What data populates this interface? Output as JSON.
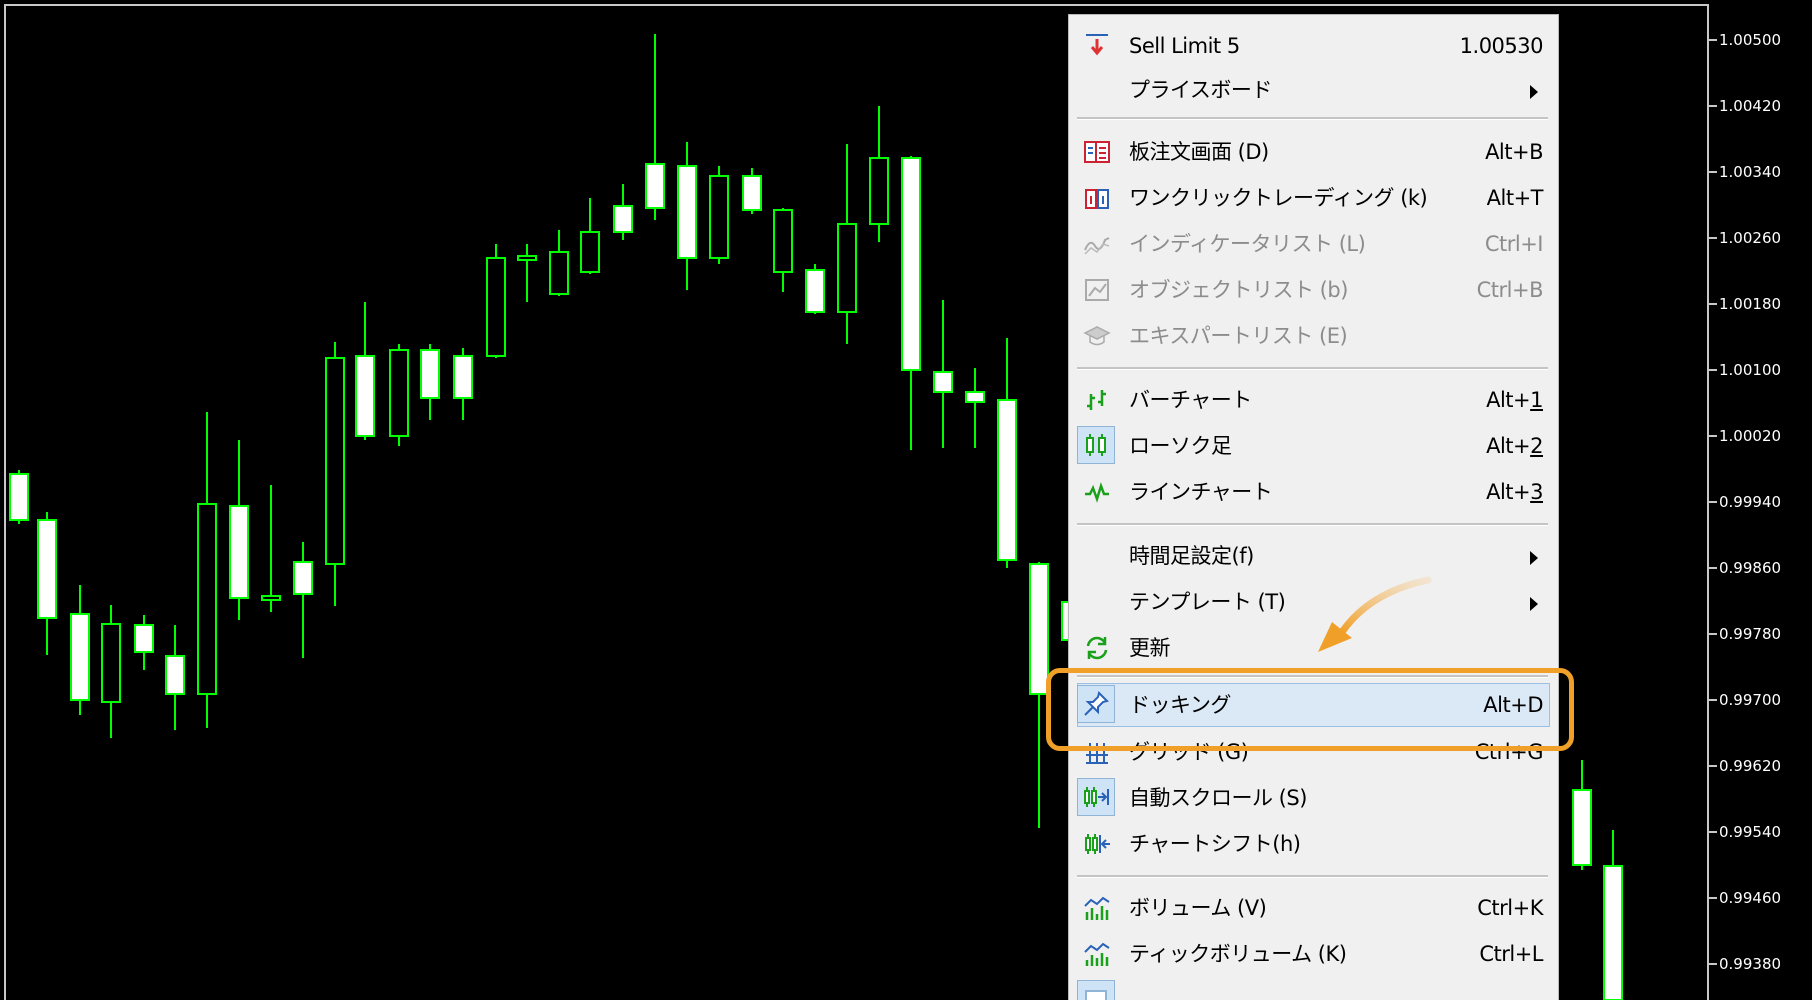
{
  "price_scale": {
    "labels": [
      "1.00500",
      "1.00420",
      "1.00340",
      "1.00260",
      "1.00180",
      "1.00100",
      "1.00020",
      "0.99940",
      "0.99860",
      "0.99780",
      "0.99700",
      "0.99620",
      "0.99540",
      "0.99460",
      "0.99380"
    ]
  },
  "chart": {
    "background": "#000000",
    "candle_up_body": "#ffffff",
    "outline": "#00ff00"
  },
  "menu": {
    "sell_limit": {
      "label": "Sell Limit 5",
      "value": "1.00530"
    },
    "price_board": {
      "label": "プライスボード"
    },
    "depth_of_market": {
      "label": "板注文画面 (D)",
      "shortcut": "Alt+B"
    },
    "one_click": {
      "label": "ワンクリックトレーディング (k)",
      "shortcut": "Alt+T"
    },
    "indicator_list": {
      "label": "インディケータリスト (L)",
      "shortcut": "Ctrl+I",
      "disabled": true
    },
    "object_list": {
      "label": "オブジェクトリスト (b)",
      "shortcut": "Ctrl+B",
      "disabled": true
    },
    "expert_list": {
      "label": "エキスパートリスト (E)",
      "disabled": true
    },
    "bar_chart": {
      "label": "バーチャート",
      "shortcut_prefix": "Alt+",
      "shortcut_key": "1"
    },
    "candlestick": {
      "label": "ローソク足",
      "shortcut_prefix": "Alt+",
      "shortcut_key": "2",
      "checked": true
    },
    "line_chart": {
      "label": "ラインチャート",
      "shortcut_prefix": "Alt+",
      "shortcut_key": "3"
    },
    "timeframe": {
      "label": "時間足設定(f)"
    },
    "template": {
      "label": "テンプレート (T)"
    },
    "refresh": {
      "label": "更新"
    },
    "docking": {
      "label": "ドッキング",
      "shortcut": "Alt+D"
    },
    "grid": {
      "label": "グリッド (G)",
      "shortcut": "Ctrl+G"
    },
    "auto_scroll": {
      "label": "自動スクロール (S)",
      "checked": true
    },
    "chart_shift": {
      "label": "チャートシフト(h)"
    },
    "volume": {
      "label": "ボリューム (V)",
      "shortcut": "Ctrl+K"
    },
    "tick_volume": {
      "label": "ティックボリューム (K)",
      "shortcut": "Ctrl+L"
    }
  },
  "highlight_color": "#f0a028"
}
